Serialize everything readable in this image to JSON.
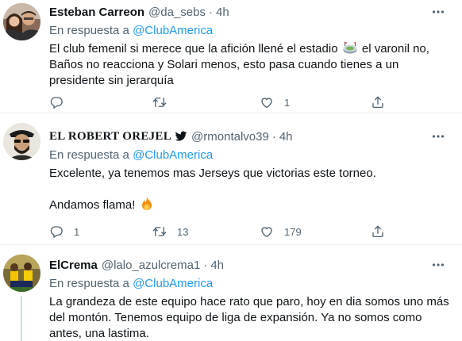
{
  "tweets": [
    {
      "name": "Esteban Carreon",
      "handle": "@da_sebs",
      "separator": "·",
      "time": "4h",
      "reply_prefix": "En respuesta a",
      "reply_mention": "@ClubAmerica",
      "text_lines": [
        "El club femenil si merece que la afición llené el estadio",
        "el varonil no,",
        "Baños no reacciona y Solari menos, esto pasa cuando tienes a un",
        "presidente sin jerarquía"
      ],
      "counts": {
        "reply": "",
        "retweet": "",
        "like": "1"
      }
    },
    {
      "name": "EL ROBERT OREJEL",
      "handle": "@rmontalvo39",
      "separator": "·",
      "time": "4h",
      "reply_prefix": "En respuesta a",
      "reply_mention": "@ClubAmerica",
      "text_lines": [
        "Excelente, ya tenemos mas Jerseys que victorias este torneo.",
        "Andamos flama!"
      ],
      "counts": {
        "reply": "1",
        "retweet": "13",
        "like": "179"
      }
    },
    {
      "name": "ElCrema",
      "handle": "@lalo_azulcrema1",
      "separator": "·",
      "time": "4h",
      "reply_prefix": "En respuesta a",
      "reply_mention": "@ClubAmerica",
      "text_lines": [
        "La grandeza de este equipo hace rato que paro, hoy en dia somos uno más",
        "del montón.  Tenemos equipo de liga de expansión. Ya no somos como",
        "antes, una lastima."
      ]
    }
  ],
  "icons": {
    "more": "more-horizontal-icon",
    "reply": "reply-icon",
    "retweet": "retweet-icon",
    "like": "heart-icon",
    "share": "share-icon",
    "verified": "twitter-bird-icon",
    "stadium": "stadium-emoji",
    "fire": "fire-emoji"
  },
  "colors": {
    "link": "#1d9bf0",
    "secondary_text": "#536471",
    "primary_text": "#0f1419",
    "divider": "#eff3f4"
  }
}
